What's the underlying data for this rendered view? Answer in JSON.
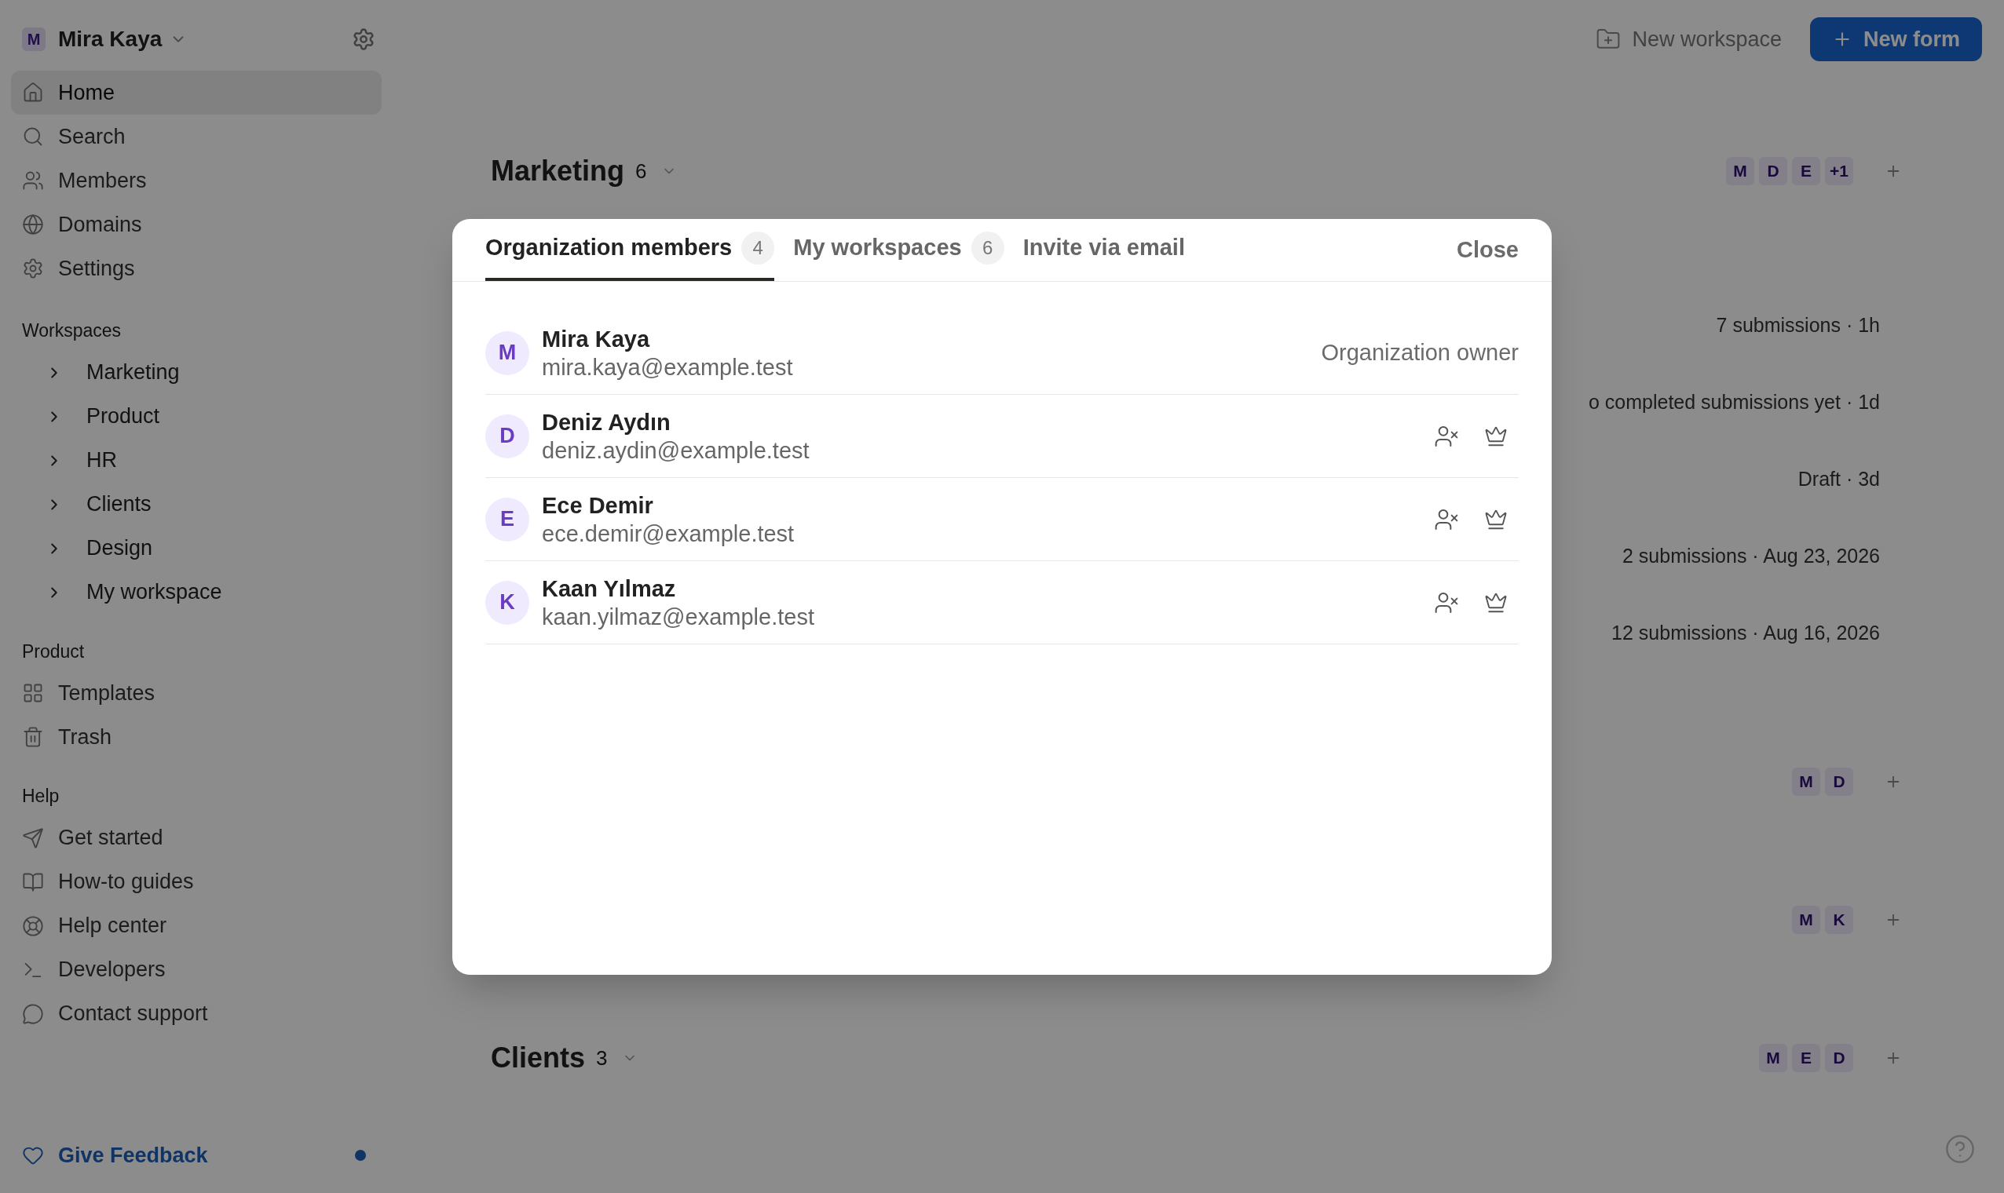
{
  "sidebar": {
    "account": {
      "initial": "M",
      "name": "Mira Kaya"
    },
    "nav": [
      {
        "label": "Home",
        "selected": true
      },
      {
        "label": "Search",
        "selected": false
      },
      {
        "label": "Members",
        "selected": false
      },
      {
        "label": "Domains",
        "selected": false
      },
      {
        "label": "Settings",
        "selected": false
      }
    ],
    "workspaces_heading": "Workspaces",
    "workspaces": [
      {
        "label": "Marketing",
        "expanded": false
      },
      {
        "label": "Product",
        "expanded": false
      },
      {
        "label": "HR",
        "expanded": false
      },
      {
        "label": "Clients",
        "expanded": false
      },
      {
        "label": "Design",
        "expanded": false
      },
      {
        "label": "My workspace",
        "expanded": false
      }
    ],
    "product_heading": "Product",
    "product": [
      {
        "label": "Templates"
      },
      {
        "label": "Trash"
      }
    ],
    "help_heading": "Help",
    "help": [
      {
        "label": "Get started"
      },
      {
        "label": "How-to guides"
      },
      {
        "label": "Help center"
      },
      {
        "label": "Developers"
      },
      {
        "label": "Contact support"
      }
    ],
    "feedback": {
      "label": "Give Feedback",
      "unread": true
    }
  },
  "toolbar": {
    "new_workspace": "New workspace",
    "new_form": "New form"
  },
  "sections": [
    {
      "title": "Marketing",
      "count": "6",
      "members": [
        "M",
        "D",
        "E",
        "+1"
      ],
      "rows": [
        "7 submissions · 1h",
        "o completed submissions yet · 1d",
        "Draft · 3d",
        "2 submissions · Aug 23, 2026",
        "12 submissions · Aug 16, 2026"
      ]
    },
    {
      "members": [
        "M",
        "D"
      ]
    },
    {
      "members": [
        "M",
        "K"
      ]
    },
    {
      "title": "Clients",
      "count": "3",
      "members": [
        "M",
        "E",
        "D"
      ]
    }
  ],
  "dialog": {
    "tabs": [
      {
        "label": "Organization members",
        "count": "4",
        "selected": true
      },
      {
        "label": "My workspaces",
        "count": "6",
        "selected": false
      },
      {
        "label": "Invite via email",
        "selected": false
      }
    ],
    "close": "Close",
    "members": [
      {
        "initial": "M",
        "name": "Mira Kaya",
        "email": "mira.kaya@example.test",
        "kind": "owner",
        "role": "Organization owner"
      },
      {
        "initial": "D",
        "name": "Deniz Aydın",
        "email": "deniz.aydin@example.test",
        "kind": "member"
      },
      {
        "initial": "E",
        "name": "Ece Demir",
        "email": "ece.demir@example.test",
        "kind": "member"
      },
      {
        "initial": "K",
        "name": "Kaan Yılmaz",
        "email": "kaan.yilmaz@example.test",
        "kind": "member"
      }
    ]
  }
}
